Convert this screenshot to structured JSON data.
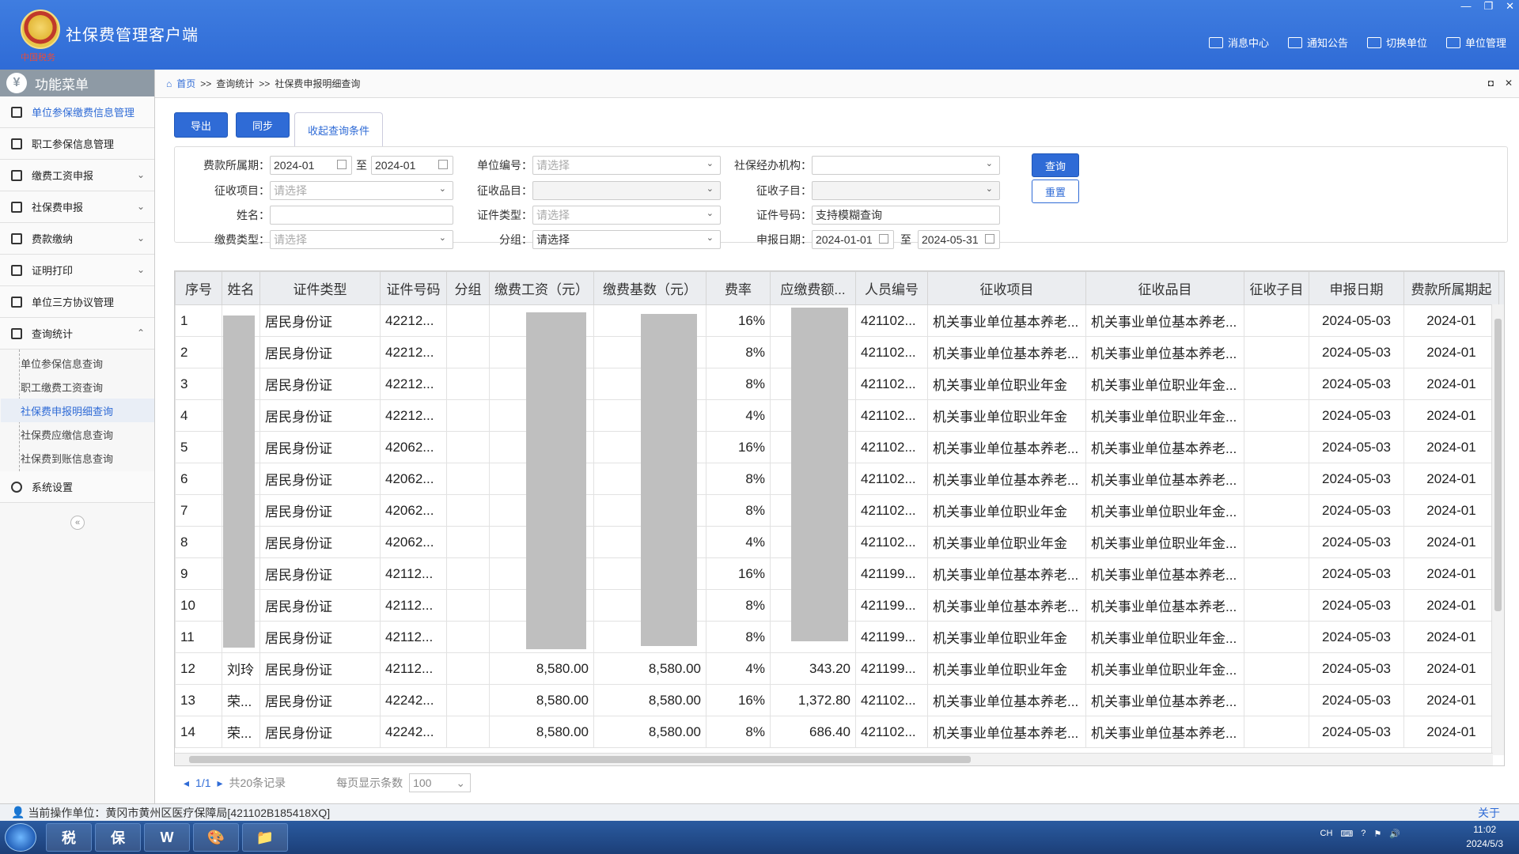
{
  "app": {
    "title": "社保费管理客户端",
    "logo_text": "中国税务",
    "window_controls": [
      "—",
      "❐",
      "✕"
    ],
    "top_actions": [
      {
        "label": "消息中心",
        "icon": "speaker-icon"
      },
      {
        "label": "通知公告",
        "icon": "mail-icon"
      },
      {
        "label": "切换单位",
        "icon": "switch-icon"
      },
      {
        "label": "单位管理",
        "icon": "building-icon"
      }
    ]
  },
  "sidebar": {
    "header": "功能菜单",
    "items": [
      {
        "label": "单位参保缴费信息管理",
        "active": true
      },
      {
        "label": "职工参保信息管理"
      },
      {
        "label": "缴费工资申报",
        "chevron": "⌄"
      },
      {
        "label": "社保费申报",
        "chevron": "⌄"
      },
      {
        "label": "费款缴纳",
        "chevron": "⌄"
      },
      {
        "label": "证明打印",
        "chevron": "⌄"
      },
      {
        "label": "单位三方协议管理"
      },
      {
        "label": "查询统计",
        "chevron": "⌃"
      }
    ],
    "submenu": [
      {
        "label": "单位参保信息查询"
      },
      {
        "label": "职工缴费工资查询"
      },
      {
        "label": "社保费申报明细查询",
        "active": true
      },
      {
        "label": "社保费应缴信息查询"
      },
      {
        "label": "社保费到账信息查询"
      }
    ],
    "settings": "系统设置",
    "collapse": "«"
  },
  "breadcrumb": {
    "home": "首页",
    "sep": ">>",
    "level1": "查询统计",
    "level2": "社保费申报明细查询"
  },
  "toolbar": {
    "export": "导出",
    "sync": "同步",
    "toggle_filter": "收起查询条件"
  },
  "form": {
    "period_label": "费款所属期：",
    "period_from": "2024-01",
    "period_to": "2024-01",
    "to": "至",
    "unit_no_label": "单位编号：",
    "unit_no_ph": "请选择",
    "agency_label": "社保经办机构：",
    "agency_value": "",
    "item_label": "征收项目：",
    "item_ph": "请选择",
    "category_label": "征收品目：",
    "category_value": "",
    "subitem_label": "征收子目：",
    "subitem_value": "",
    "name_label": "姓名：",
    "name_value": "",
    "idtype_label": "证件类型：",
    "idtype_ph": "请选择",
    "idno_label": "证件号码：",
    "idno_value": "支持模糊查询",
    "paytype_label": "缴费类型：",
    "paytype_ph": "请选择",
    "group_label": "分组：",
    "group_value": "请选择",
    "decl_date_label": "申报日期：",
    "decl_from": "2024-01-01",
    "decl_to": "2024-05-31",
    "query": "查询",
    "reset": "重置"
  },
  "table": {
    "columns": [
      "序号",
      "姓名",
      "证件类型",
      "证件号码",
      "分组",
      "缴费工资（元）",
      "缴费基数（元）",
      "费率",
      "应缴费额...",
      "人员编号",
      "征收项目",
      "征收品目",
      "征收子目",
      "申报日期",
      "费款所属期起",
      "费"
    ],
    "rows": [
      [
        "1",
        "",
        "居民身份证",
        "42212...",
        "",
        "",
        "",
        "16%",
        "",
        "421102...",
        "机关事业单位基本养老...",
        "机关事业单位基本养老...",
        "",
        "2024-05-03",
        "2024-01"
      ],
      [
        "2",
        "",
        "居民身份证",
        "42212...",
        "",
        "",
        "",
        "8%",
        "",
        "421102...",
        "机关事业单位基本养老...",
        "机关事业单位基本养老...",
        "",
        "2024-05-03",
        "2024-01"
      ],
      [
        "3",
        "",
        "居民身份证",
        "42212...",
        "",
        "",
        "",
        "8%",
        "",
        "421102...",
        "机关事业单位职业年金",
        "机关事业单位职业年金...",
        "",
        "2024-05-03",
        "2024-01"
      ],
      [
        "4",
        "",
        "居民身份证",
        "42212...",
        "",
        "",
        "",
        "4%",
        "",
        "421102...",
        "机关事业单位职业年金",
        "机关事业单位职业年金...",
        "",
        "2024-05-03",
        "2024-01"
      ],
      [
        "5",
        "",
        "居民身份证",
        "42062...",
        "",
        "",
        "",
        "16%",
        "",
        "421102...",
        "机关事业单位基本养老...",
        "机关事业单位基本养老...",
        "",
        "2024-05-03",
        "2024-01"
      ],
      [
        "6",
        "",
        "居民身份证",
        "42062...",
        "",
        "",
        "",
        "8%",
        "",
        "421102...",
        "机关事业单位基本养老...",
        "机关事业单位基本养老...",
        "",
        "2024-05-03",
        "2024-01"
      ],
      [
        "7",
        "",
        "居民身份证",
        "42062...",
        "",
        "",
        "",
        "8%",
        "",
        "421102...",
        "机关事业单位职业年金",
        "机关事业单位职业年金...",
        "",
        "2024-05-03",
        "2024-01"
      ],
      [
        "8",
        "",
        "居民身份证",
        "42062...",
        "",
        "",
        "",
        "4%",
        "",
        "421102...",
        "机关事业单位职业年金",
        "机关事业单位职业年金...",
        "",
        "2024-05-03",
        "2024-01"
      ],
      [
        "9",
        "",
        "居民身份证",
        "42112...",
        "",
        "",
        "",
        "16%",
        "",
        "421199...",
        "机关事业单位基本养老...",
        "机关事业单位基本养老...",
        "",
        "2024-05-03",
        "2024-01"
      ],
      [
        "10",
        "",
        "居民身份证",
        "42112...",
        "",
        "",
        "",
        "8%",
        "",
        "421199...",
        "机关事业单位基本养老...",
        "机关事业单位基本养老...",
        "",
        "2024-05-03",
        "2024-01"
      ],
      [
        "11",
        "",
        "居民身份证",
        "42112...",
        "",
        "",
        "",
        "8%",
        "",
        "421199...",
        "机关事业单位职业年金",
        "机关事业单位职业年金...",
        "",
        "2024-05-03",
        "2024-01"
      ],
      [
        "12",
        "刘玲",
        "居民身份证",
        "42112...",
        "",
        "8,580.00",
        "8,580.00",
        "4%",
        "343.20",
        "421199...",
        "机关事业单位职业年金",
        "机关事业单位职业年金...",
        "",
        "2024-05-03",
        "2024-01"
      ],
      [
        "13",
        "荣...",
        "居民身份证",
        "42242...",
        "",
        "8,580.00",
        "8,580.00",
        "16%",
        "1,372.80",
        "421102...",
        "机关事业单位基本养老...",
        "机关事业单位基本养老...",
        "",
        "2024-05-03",
        "2024-01"
      ],
      [
        "14",
        "荣...",
        "居民身份证",
        "42242...",
        "",
        "8,580.00",
        "8,580.00",
        "8%",
        "686.40",
        "421102...",
        "机关事业单位基本养老...",
        "机关事业单位基本养老...",
        "",
        "2024-05-03",
        "2024-01"
      ]
    ]
  },
  "pager": {
    "page": "1/1",
    "total": "共20条记录",
    "per_page_label": "每页显示条数",
    "per_page": "100"
  },
  "status": {
    "unit": "当前操作单位：黄冈市黄州区医疗保障局[421102B185418XQ]",
    "about": "关于"
  },
  "taskbar": {
    "apps": [
      "税",
      "保",
      "W",
      "🎨",
      "📁"
    ],
    "lang": "CH",
    "time": "11:02",
    "date": "2024/5/3"
  },
  "colors": {
    "primary": "#2f6bd6",
    "header_bg": "#3f7de0",
    "sidebar_head": "#8e9aa5",
    "redaction": "#bfbfbf"
  }
}
